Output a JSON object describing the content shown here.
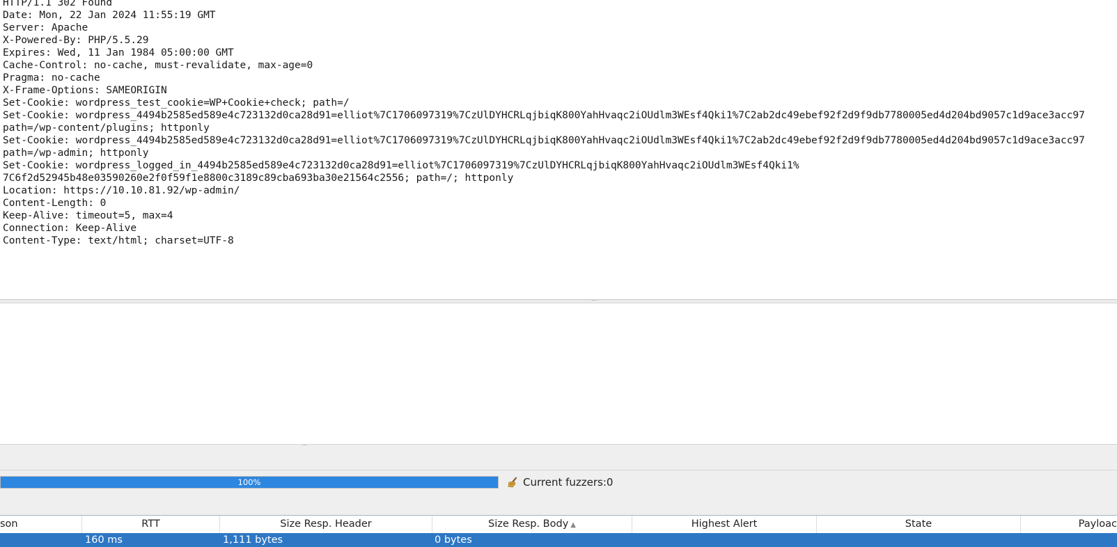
{
  "response": {
    "lines": [
      "HTTP/1.1 302 Found",
      "Date: Mon, 22 Jan 2024 11:55:19 GMT",
      "Server: Apache",
      "X-Powered-By: PHP/5.5.29",
      "Expires: Wed, 11 Jan 1984 05:00:00 GMT",
      "Cache-Control: no-cache, must-revalidate, max-age=0",
      "Pragma: no-cache",
      "X-Frame-Options: SAMEORIGIN",
      "Set-Cookie: wordpress_test_cookie=WP+Cookie+check; path=/",
      "Set-Cookie: wordpress_4494b2585ed589e4c723132d0ca28d91=elliot%7C1706097319%7CzUlDYHCRLqjbiqK800YahHvaqc2iOUdlm3WEsf4Qki1%7C2ab2dc49ebef92f2d9f9db7780005ed4d204bd9057c1d9ace3acc97",
      "path=/wp-content/plugins; httponly",
      "Set-Cookie: wordpress_4494b2585ed589e4c723132d0ca28d91=elliot%7C1706097319%7CzUlDYHCRLqjbiqK800YahHvaqc2iOUdlm3WEsf4Qki1%7C2ab2dc49ebef92f2d9f9db7780005ed4d204bd9057c1d9ace3acc97",
      "path=/wp-admin; httponly",
      "Set-Cookie: wordpress_logged_in_4494b2585ed589e4c723132d0ca28d91=elliot%7C1706097319%7CzUlDYHCRLqjbiqK800YahHvaqc2iOUdlm3WEsf4Qki1%",
      "7C6f2d52945b48e03590260e2f0f59f1e8800c3189c89cba693ba30e21564c2556; path=/; httponly",
      "Location: https://10.10.81.92/wp-admin/",
      "Content-Length: 0",
      "Keep-Alive: timeout=5, max=4",
      "Connection: Keep-Alive",
      "Content-Type: text/html; charset=UTF-8"
    ]
  },
  "status": {
    "progress_label": "100%",
    "progress_fraction": 1.0,
    "fuzzer_label": "Current fuzzers:0",
    "icon": "broom-icon"
  },
  "table": {
    "columns": [
      "son",
      "RTT",
      "Size Resp. Header",
      "Size Resp. Body",
      "Highest Alert",
      "State",
      "Payloac"
    ],
    "sorted_column": "Size Resp. Body",
    "selected_row": {
      "rtt": "160 ms",
      "size_resp_header": "1,111 bytes",
      "size_resp_body": "0 bytes"
    }
  },
  "colors": {
    "progress": "#2d86e0",
    "selection": "#2d77c5"
  }
}
